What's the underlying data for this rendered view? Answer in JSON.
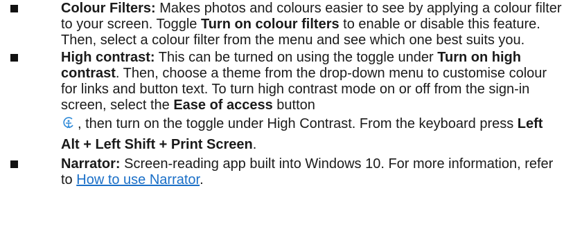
{
  "items": [
    {
      "title": "Colour Filters:",
      "text_1": " Makes photos and colours easier to see by applying a colour filter to your screen. Toggle ",
      "bold_1": "Turn on colour filters",
      "text_2": " to enable or disable this feature. Then, select a colour filter from the menu and see which one best suits you."
    },
    {
      "title": "High contrast:",
      "text_1": " This can be turned on using the toggle under ",
      "bold_1": "Turn on high contrast",
      "text_2": ". Then, choose a theme from the drop-down menu to customise colour for links and button text. To turn high contrast mode on or off from the sign-in screen, select the ",
      "bold_2": "Ease of access",
      "text_3": " button",
      "icon": "ease-of-access-icon",
      "text_4": ", then turn on the toggle under High Contrast. From the keyboard press ",
      "bold_3": "Left Alt + Left Shift + Print Screen",
      "text_5": "."
    },
    {
      "title": "Narrator:",
      "text_1": " Screen-reading app built into Windows 10. For more information, refer to ",
      "link": "How to use Narrator",
      "text_2": "."
    }
  ],
  "colors": {
    "text": "#1a1a1a",
    "link": "#1a6fc7",
    "icon": "#2f8ad8"
  }
}
